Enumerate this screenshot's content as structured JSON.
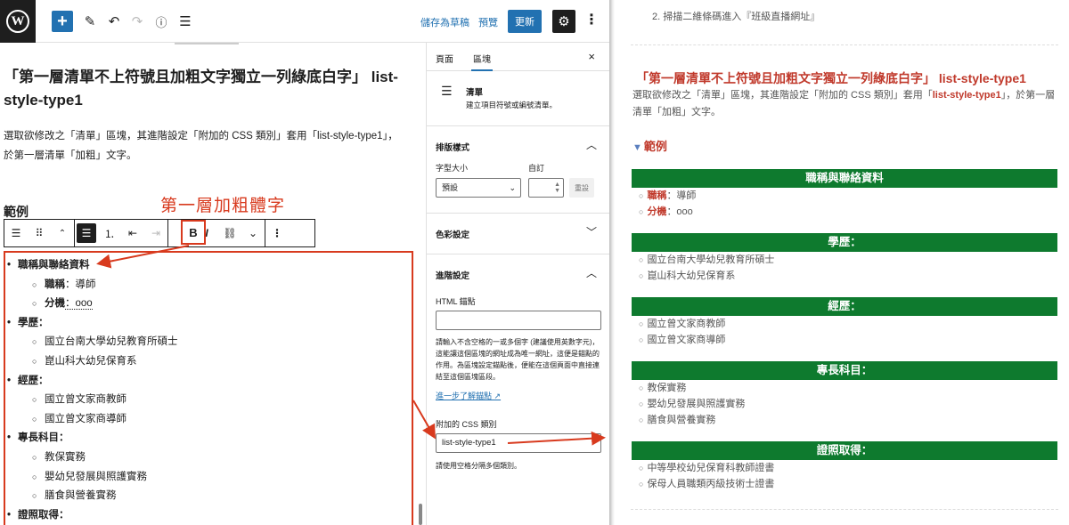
{
  "topbar": {
    "save_draft": "儲存為草稿",
    "preview": "預覽",
    "update": "更新"
  },
  "editor": {
    "heading": "「第一層清單不上符號且加粗文字獨立一列綠底白字」 list-style-type1",
    "intro": "選取欲修改之「清單」區塊，其進階設定「附加的 CSS 類別」套用「list-style-type1」，於第一層清單「加粗」文字。",
    "example_heading": "範例",
    "annotation_label": "第一層加粗體字",
    "bold_button": "B",
    "italic_button": "I",
    "list": [
      {
        "label": "職稱與聯絡資料",
        "children": [
          {
            "k": "職稱",
            "v": "：導師"
          },
          {
            "k": "分機",
            "v": "：ooo"
          }
        ]
      },
      {
        "label": "學歷：",
        "children": [
          {
            "v": "國立台南大學幼兒教育所碩士"
          },
          {
            "v": "崑山科大幼兒保育系"
          }
        ]
      },
      {
        "label": "經歷：",
        "children": [
          {
            "v": "國立曾文家商教師"
          },
          {
            "v": "國立曾文家商導師"
          }
        ]
      },
      {
        "label": "專長科目：",
        "children": [
          {
            "v": "教保實務"
          },
          {
            "v": "嬰幼兒發展與照護實務"
          },
          {
            "v": "膳食與營養實務"
          }
        ]
      },
      {
        "label": "證照取得：",
        "children": []
      }
    ]
  },
  "sidebar": {
    "tab_page": "頁面",
    "tab_block": "區塊",
    "close": "×",
    "block_title": "清單",
    "block_desc": "建立項目符號或編號清單。",
    "typography_title": "排版樣式",
    "font_size_label": "字型大小",
    "custom_label": "自訂",
    "font_size_value": "預設",
    "reset": "重設",
    "color_title": "色彩設定",
    "advanced_title": "進階設定",
    "anchor_label": "HTML 錨點",
    "anchor_help": "請輸入不含空格的一或多個字 (建議使用英數字元)，這能讓這個區塊的網址成為唯一網址，這便是錨點的作用。為區塊設定錨點後，便能在這個頁面中直接連結至這個區塊區段。",
    "learn_more": "進一步了解錨點",
    "css_label": "附加的 CSS 類別",
    "css_value": "list-style-type1",
    "css_help": "請使用空格分隔多個類別。"
  },
  "preview": {
    "top_item": "2. 掃描二維條碼進入『班級直播網址』",
    "heading": "「第一層清單不上符號且加粗文字獨立一列綠底白字」 list-style-type1",
    "intro_a": "選取欲修改之「清單」區塊，其進階設定「附加的 CSS 類別」套用「",
    "intro_code": "list-style-type1",
    "intro_b": "」，於第一層清單「加粗」文字。",
    "example": "範例",
    "sections": [
      {
        "title": "職稱與聯絡資料",
        "items": [
          {
            "k": "職稱",
            "v": "：導師"
          },
          {
            "k": "分機",
            "v": "：ooo"
          }
        ]
      },
      {
        "title": "學歷：",
        "items": [
          {
            "v": "國立台南大學幼兒教育所碩士"
          },
          {
            "v": "崑山科大幼兒保育系"
          }
        ]
      },
      {
        "title": "經歷：",
        "items": [
          {
            "v": "國立曾文家商教師"
          },
          {
            "v": "國立曾文家商導師"
          }
        ]
      },
      {
        "title": "專長科目：",
        "items": [
          {
            "v": "教保實務"
          },
          {
            "v": "嬰幼兒發展與照護實務"
          },
          {
            "v": "膳食與營養實務"
          }
        ]
      },
      {
        "title": "證照取得：",
        "items": [
          {
            "v": "中等學校幼兒保育科教師證書"
          },
          {
            "v": "保母人員職類丙級技術士證書"
          }
        ]
      }
    ]
  },
  "colors": {
    "accent": "#2271b1",
    "annotation": "#d83a1e",
    "green_bar": "#0e7a2e",
    "heading_red": "#c0392b"
  }
}
